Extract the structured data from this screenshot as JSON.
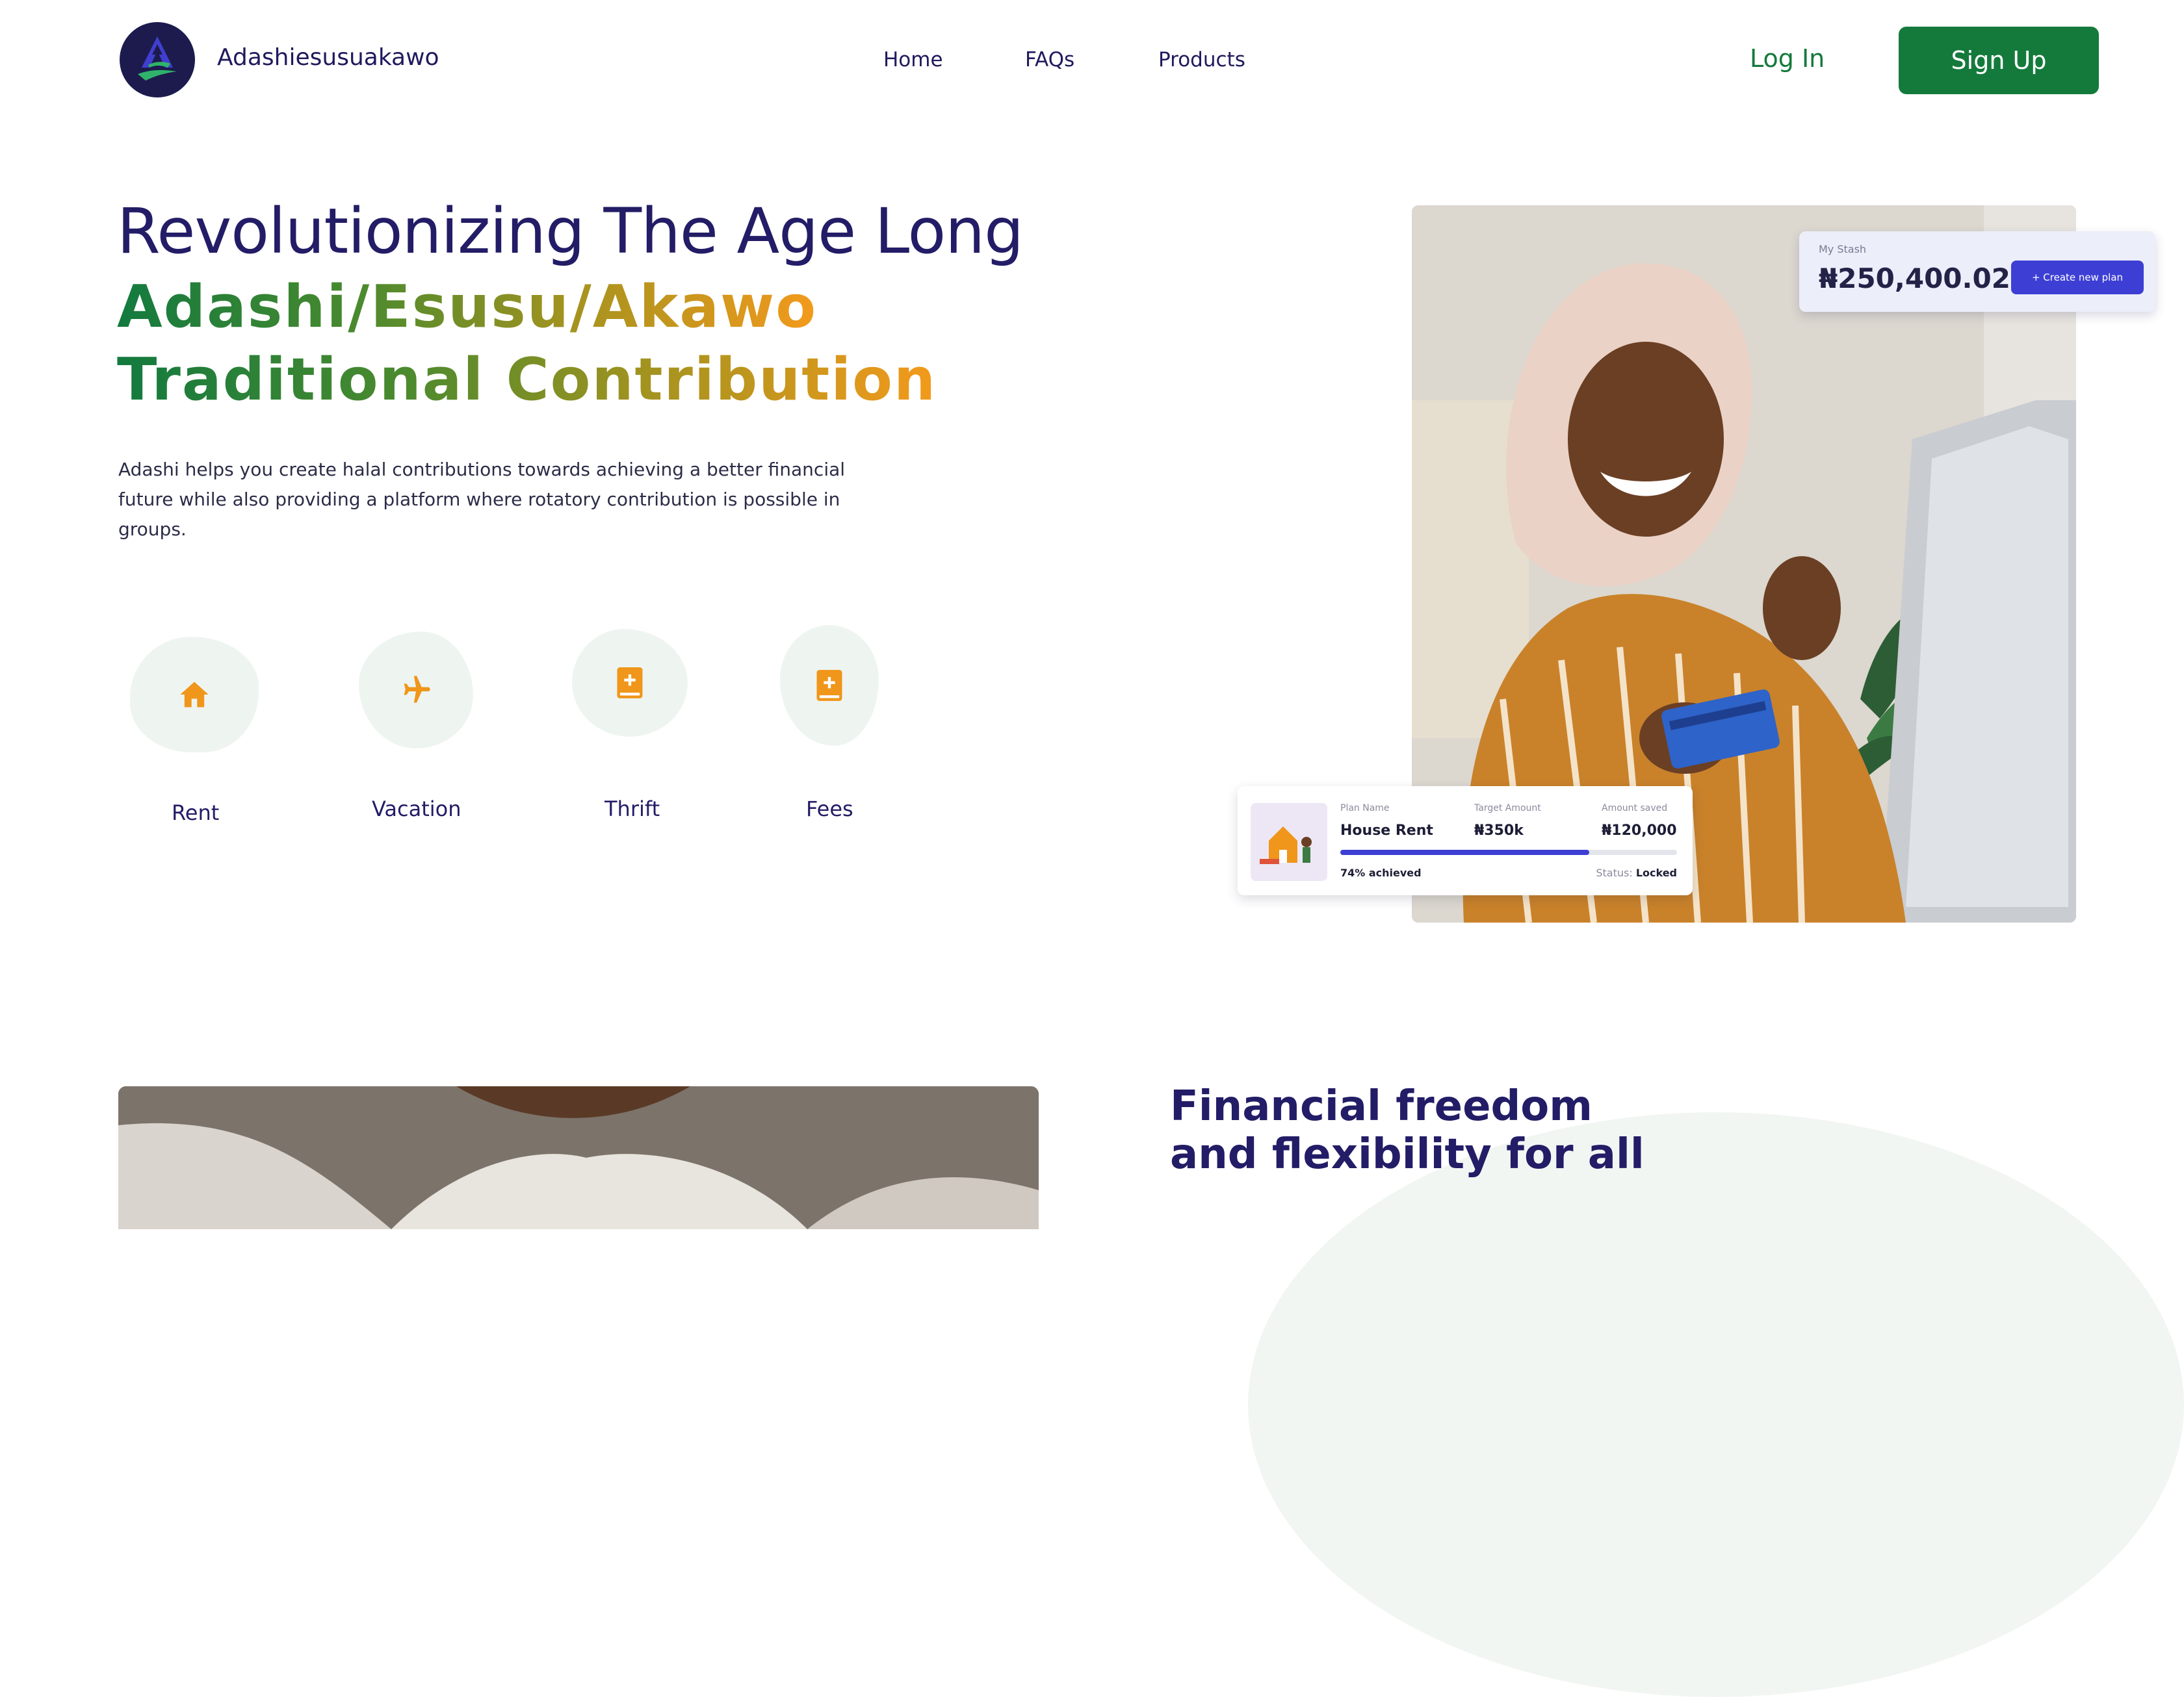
{
  "header": {
    "brand": "Adashiesusuakawo",
    "nav": [
      "Home",
      "FAQs",
      "Products"
    ],
    "login_label": "Log In",
    "signup_label": "Sign Up"
  },
  "hero": {
    "line1": "Revolutionizing The Age Long",
    "line2": "Adashi/Esusu/Akawo",
    "line3": "Traditional Contribution",
    "description": "Adashi helps you create halal contributions towards achieving a better financial future while also providing a platform where rotatory contribution is possible in groups.",
    "categories": [
      {
        "label": "Rent",
        "icon": "home-icon"
      },
      {
        "label": "Vacation",
        "icon": "airplane-icon"
      },
      {
        "label": "Thrift",
        "icon": "add-book-icon"
      },
      {
        "label": "Fees",
        "icon": "add-book-icon"
      }
    ]
  },
  "stash_card": {
    "label": "My Stash",
    "amount": "₦250,400.02",
    "button_label": "+ Create new plan"
  },
  "plan_card": {
    "plan_name_label": "Plan Name",
    "plan_name": "House Rent",
    "target_label": "Target Amount",
    "target": "₦350k",
    "saved_label": "Amount saved",
    "saved": "₦120,000",
    "progress_fraction": 0.74,
    "achieved_text": "74% achieved",
    "status_label": "Status:",
    "status": "Locked"
  },
  "section2": {
    "title": "Financial freedom and flexibility for all"
  },
  "colors": {
    "brand_navy": "#231c66",
    "brand_green": "#147a3c",
    "accent_orange": "#f39a1c",
    "plan_blue": "#3d3fd4",
    "icon_bg": "#eef5f1"
  }
}
